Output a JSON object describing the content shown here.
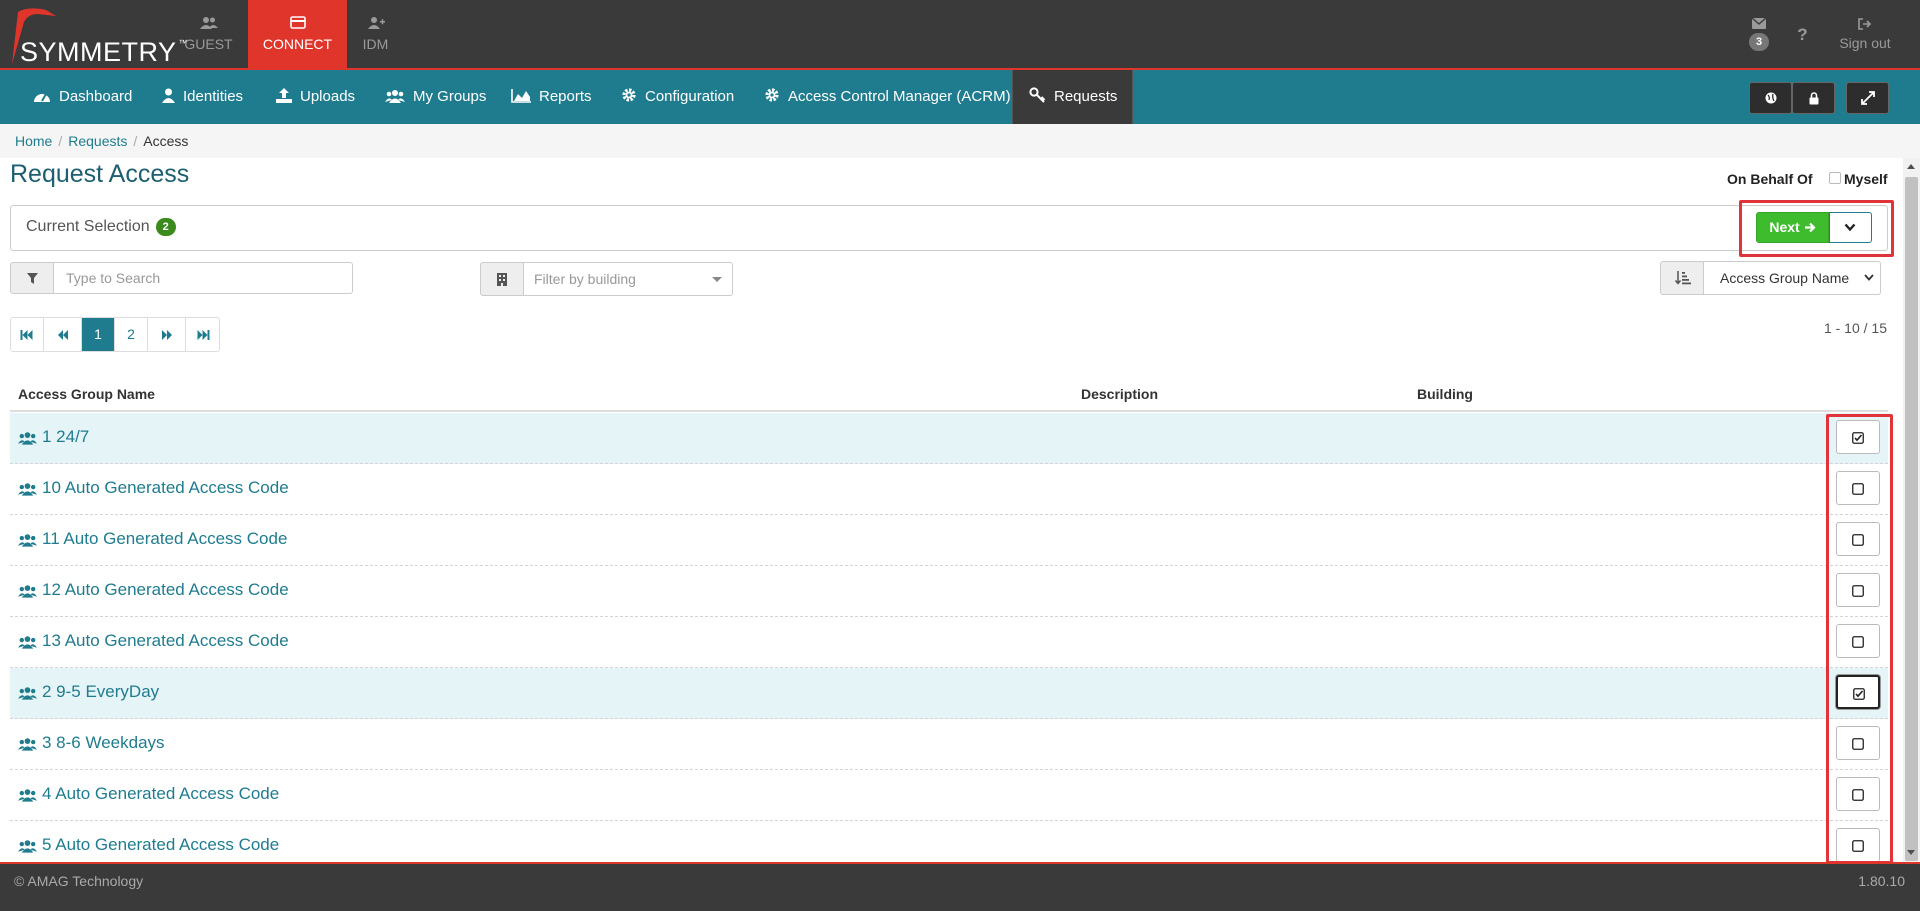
{
  "brand": {
    "name": "SYMMETRY",
    "tm": "™"
  },
  "app_tabs": [
    {
      "label": "GUEST",
      "icon": "users-icon"
    },
    {
      "label": "CONNECT",
      "icon": "card-icon",
      "active": true
    },
    {
      "label": "IDM",
      "icon": "user-plus-icon"
    }
  ],
  "top_right": {
    "mail_count": "3",
    "help": "?",
    "sign_out": "Sign out"
  },
  "nav": {
    "items": [
      {
        "label": "Dashboard",
        "icon": "dashboard-icon"
      },
      {
        "label": "Identities",
        "icon": "user-icon"
      },
      {
        "label": "Uploads",
        "icon": "upload-icon"
      },
      {
        "label": "My Groups",
        "icon": "users-icon"
      },
      {
        "label": "Reports",
        "icon": "area-chart-icon"
      },
      {
        "label": "Configuration",
        "icon": "gear-icon"
      },
      {
        "label": "Access Control Manager (ACRM)",
        "icon": "gear-icon"
      },
      {
        "label": "Requests",
        "icon": "key-icon",
        "active": true
      }
    ],
    "right_buttons": [
      "globe-icon",
      "lock-icon",
      "expand-icon"
    ]
  },
  "breadcrumb": {
    "home": "Home",
    "requests": "Requests",
    "current": "Access",
    "separator": "/"
  },
  "page": {
    "title": "Request Access",
    "on_behalf_label": "On Behalf Of",
    "myself_label": "Myself",
    "current_selection_label": "Current Selection",
    "selection_count": "2",
    "next_label": "Next"
  },
  "filters": {
    "search_placeholder": "Type to Search",
    "building_placeholder": "Filter by building",
    "sort_value": "Access Group Name"
  },
  "pagination": {
    "pages": [
      "1",
      "2"
    ],
    "current": "1",
    "range": "1 - 10 / 15"
  },
  "table": {
    "columns": [
      "Access Group Name",
      "Description",
      "Building"
    ],
    "rows": [
      {
        "name": "1 24/7",
        "checked": true
      },
      {
        "name": "10 Auto Generated Access Code",
        "checked": false
      },
      {
        "name": "11 Auto Generated Access Code",
        "checked": false
      },
      {
        "name": "12 Auto Generated Access Code",
        "checked": false
      },
      {
        "name": "13 Auto Generated Access Code",
        "checked": false
      },
      {
        "name": "2 9-5 EveryDay",
        "checked": true
      },
      {
        "name": "3 8-6 Weekdays",
        "checked": false
      },
      {
        "name": "4 Auto Generated Access Code",
        "checked": false
      },
      {
        "name": "5 Auto Generated Access Code",
        "checked": false
      }
    ]
  },
  "footer": {
    "copyright": "© AMAG Technology",
    "version": "1.80.10"
  },
  "colors": {
    "brand_red": "#e0352b",
    "nav_teal": "#1f7c8e",
    "next_green": "#3fbb2e",
    "highlight": "#e0333a"
  }
}
